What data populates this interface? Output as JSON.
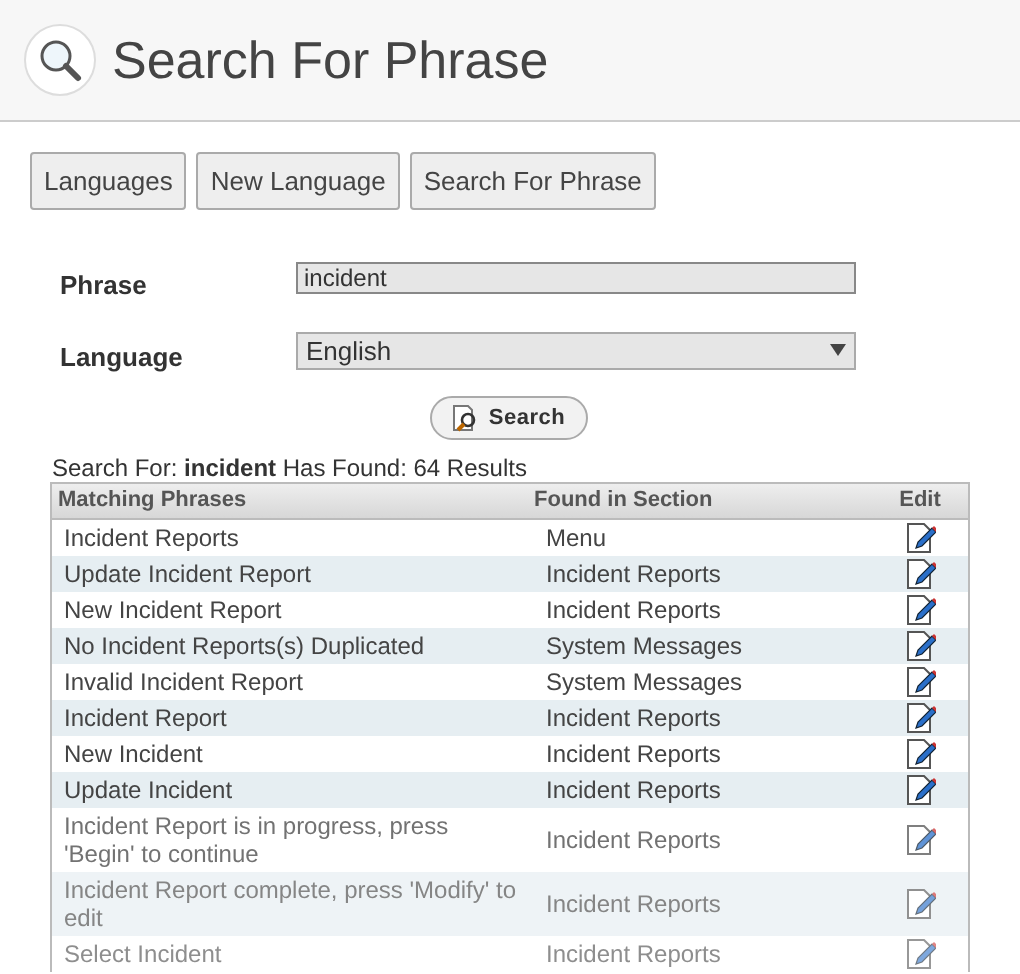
{
  "header": {
    "title": "Search For Phrase"
  },
  "nav_buttons": [
    "Languages",
    "New Language",
    "Search For Phrase"
  ],
  "form": {
    "phrase_label": "Phrase",
    "phrase_value": "incident",
    "language_label": "Language",
    "language_value": "English",
    "search_button": "Search"
  },
  "summary": "Search For: **incident** Has Found: 64 Results",
  "table": {
    "columns": [
      "Matching Phrases",
      "Found in Section",
      "Edit"
    ],
    "rows": [
      {
        "phrase": "Incident Reports",
        "section": "Menu"
      },
      {
        "phrase": "Update Incident Report",
        "section": "Incident Reports"
      },
      {
        "phrase": "New Incident Report",
        "section": "Incident Reports"
      },
      {
        "phrase": "No Incident Reports(s) Duplicated",
        "section": "System Messages"
      },
      {
        "phrase": "Invalid Incident Report",
        "section": "System Messages"
      },
      {
        "phrase": "Incident Report",
        "section": "Incident Reports"
      },
      {
        "phrase": "New Incident",
        "section": "Incident Reports"
      },
      {
        "phrase": "Update Incident",
        "section": "Incident Reports"
      },
      {
        "phrase": "Incident Report is in progress, press 'Begin' to continue",
        "section": "Incident Reports"
      },
      {
        "phrase": "Incident Report complete, press 'Modify' to edit",
        "section": "Incident Reports"
      },
      {
        "phrase": "Select Incident",
        "section": "Incident Reports"
      }
    ]
  }
}
